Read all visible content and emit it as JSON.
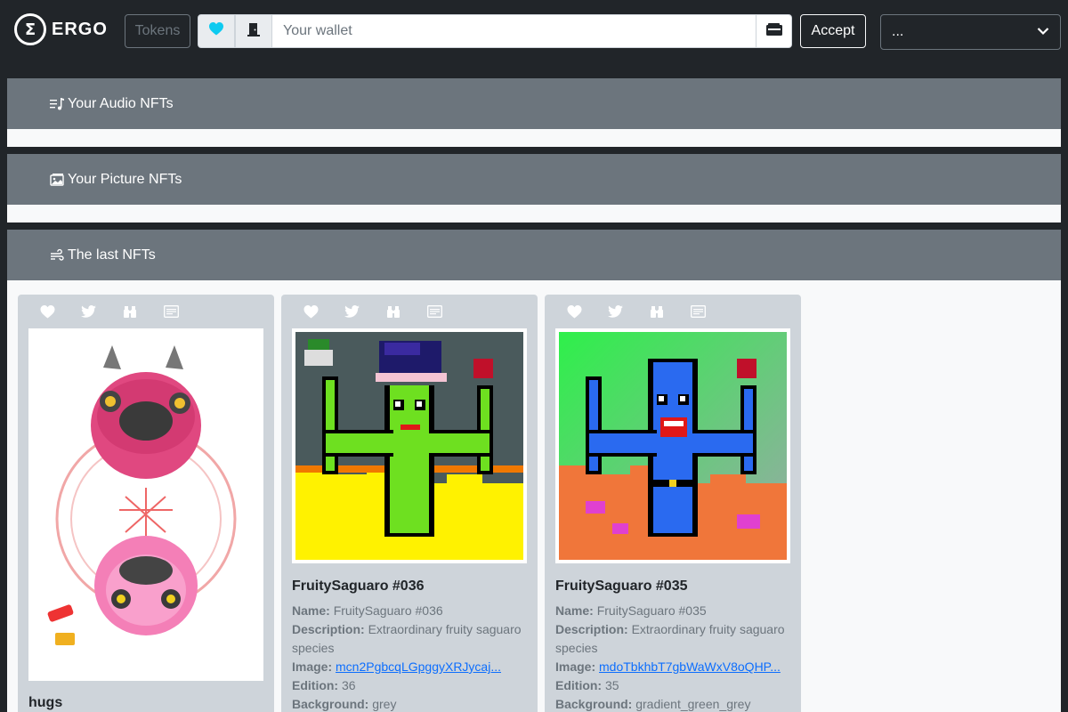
{
  "navbar": {
    "logo_symbol": "Σ",
    "logo_text": "ERGO",
    "tokens_label": "Tokens",
    "wallet_placeholder": "Your wallet",
    "wallet_value": "",
    "accept_label": "Accept",
    "select_value": "...",
    "icons": [
      "heart-icon",
      "door-icon",
      "wallet-icon",
      "chevron-down-icon"
    ],
    "colors": {
      "heart": "#0dcaf0",
      "bg": "#212529"
    }
  },
  "sections": {
    "audio": {
      "title": "Your Audio NFTs",
      "icon": "music-list-icon"
    },
    "picture": {
      "title": "Your Picture NFTs",
      "icon": "images-icon"
    },
    "last": {
      "title": "The last NFTs",
      "icon": "wind-icon"
    }
  },
  "cards": [
    {
      "title": "hugs",
      "image_icon": "pink-pig-artwork",
      "actions": [
        "heart-icon",
        "twitter-icon",
        "binoculars-icon",
        "card-text-icon"
      ]
    },
    {
      "title": "FruitySaguaro #036",
      "name_label": "Name:",
      "name": "FruitySaguaro #036",
      "desc_label": "Description:",
      "description": "Extraordinary fruity saguaro species",
      "image_label": "Image:",
      "image_link": "mcn2PgbcqLGpggyXRJycaj...",
      "edition_label": "Edition:",
      "edition": "36",
      "bg_label": "Background:",
      "background": "grey",
      "image_icon": "green-cactus-pixel-art",
      "actions": [
        "heart-icon",
        "twitter-icon",
        "binoculars-icon",
        "card-text-icon"
      ]
    },
    {
      "title": "FruitySaguaro #035",
      "name_label": "Name:",
      "name": "FruitySaguaro #035",
      "desc_label": "Description:",
      "description": "Extraordinary fruity saguaro species",
      "image_label": "Image:",
      "image_link": "mdoTbkhbT7gbWaWxV8oQHP...",
      "edition_label": "Edition:",
      "edition": "35",
      "bg_label": "Background:",
      "background": "gradient_green_grey",
      "image_icon": "blue-cactus-pixel-art",
      "actions": [
        "heart-icon",
        "twitter-icon",
        "binoculars-icon",
        "card-text-icon"
      ]
    }
  ]
}
